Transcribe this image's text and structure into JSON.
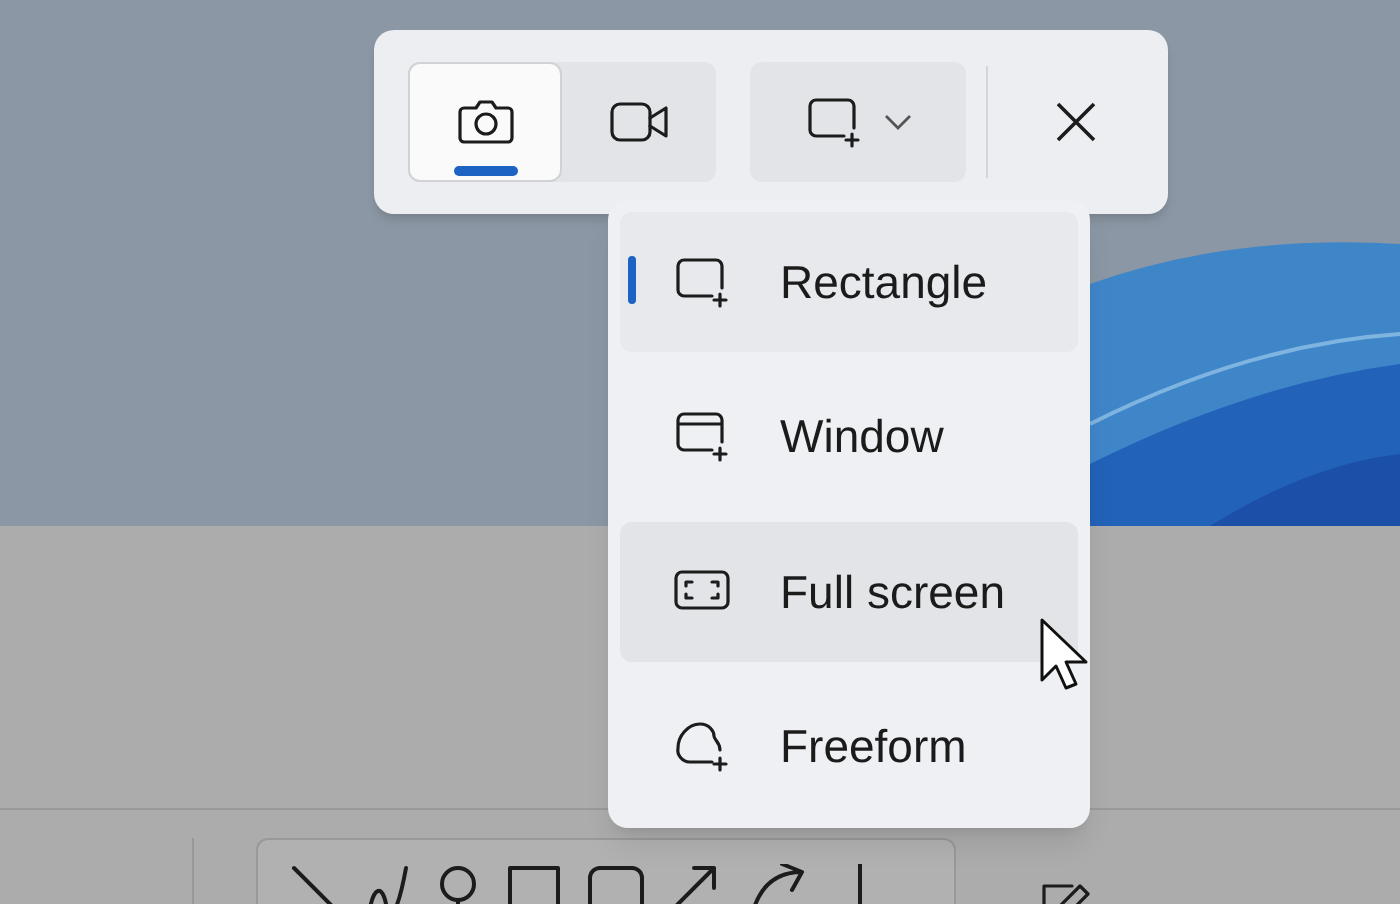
{
  "capture_toolbar": {
    "modes": [
      {
        "kind": "photo",
        "selected": true
      },
      {
        "kind": "video",
        "selected": false
      }
    ]
  },
  "shape_menu": {
    "items": [
      {
        "label": "Rectangle",
        "kind": "rectangle",
        "selected": true,
        "hovered": false
      },
      {
        "label": "Window",
        "kind": "window",
        "selected": false,
        "hovered": false
      },
      {
        "label": "Full screen",
        "kind": "fullscreen",
        "selected": false,
        "hovered": true
      },
      {
        "label": "Freeform",
        "kind": "freeform",
        "selected": false,
        "hovered": false
      }
    ]
  }
}
